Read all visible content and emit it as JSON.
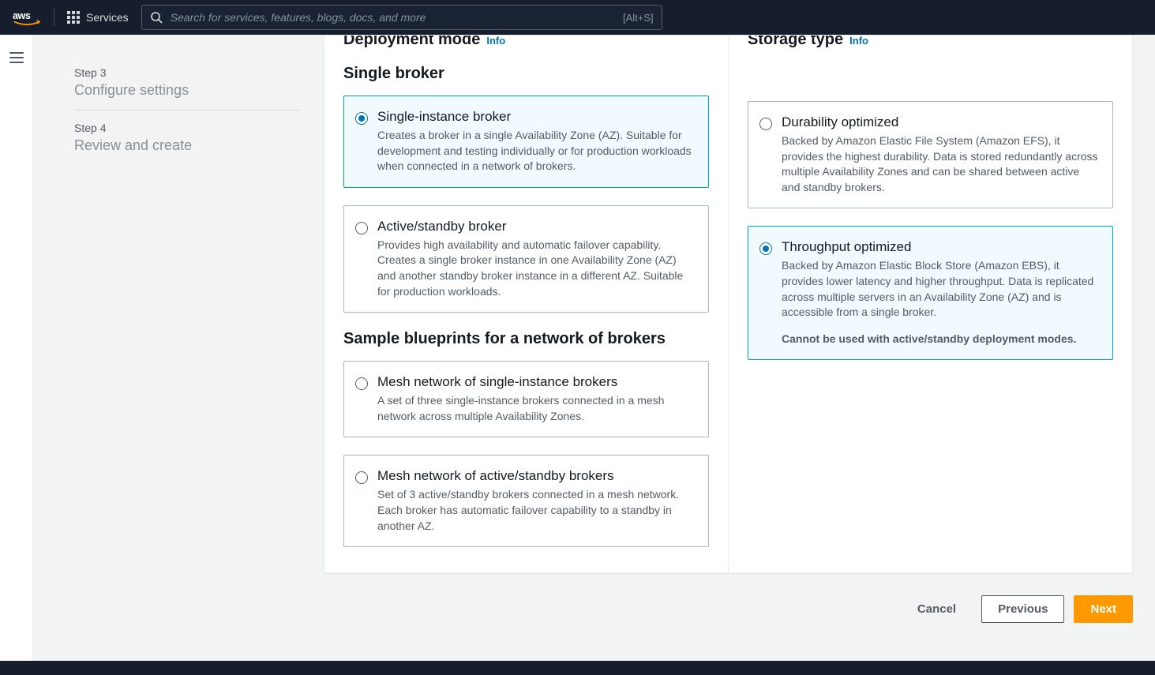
{
  "nav": {
    "services_label": "Services",
    "search_placeholder": "Search for services, features, blogs, docs, and more",
    "search_shortcut": "[Alt+S]"
  },
  "steps": [
    {
      "label": "Step 3",
      "title": "Configure settings"
    },
    {
      "label": "Step 4",
      "title": "Review and create"
    }
  ],
  "deployment": {
    "heading": "Deployment mode",
    "info": "Info",
    "single_heading": "Single broker",
    "blueprints_heading": "Sample blueprints for a network of brokers",
    "tiles": {
      "single": {
        "title": "Single-instance broker",
        "desc": "Creates a broker in a single Availability Zone (AZ). Suitable for development and testing individually or for production workloads when connected in a network of brokers."
      },
      "active": {
        "title": "Active/standby broker",
        "desc": "Provides high availability and automatic failover capability. Creates a single broker instance in one Availability Zone (AZ) and another standby broker instance in a different AZ. Suitable for production workloads."
      },
      "mesh_single": {
        "title": "Mesh network of single-instance brokers",
        "desc": "A set of three single-instance brokers connected in a mesh network across multiple Availability Zones."
      },
      "mesh_active": {
        "title": "Mesh network of active/standby brokers",
        "desc": "Set of 3 active/standby brokers connected in a mesh network. Each broker has automatic failover capability to a standby in another AZ."
      }
    }
  },
  "storage": {
    "heading": "Storage type",
    "info": "Info",
    "tiles": {
      "durability": {
        "title": "Durability optimized",
        "desc": "Backed by Amazon Elastic File System (Amazon EFS), it provides the highest durability. Data is stored redundantly across multiple Availability Zones and can be shared between active and standby brokers."
      },
      "throughput": {
        "title": "Throughput optimized",
        "desc": "Backed by Amazon Elastic Block Store (Amazon EBS), it provides lower latency and higher throughput. Data is replicated across multiple servers in an Availability Zone (AZ) and is accessible from a single broker.",
        "note": "Cannot be used with active/standby deployment modes."
      }
    }
  },
  "footer": {
    "cancel": "Cancel",
    "previous": "Previous",
    "next": "Next"
  }
}
